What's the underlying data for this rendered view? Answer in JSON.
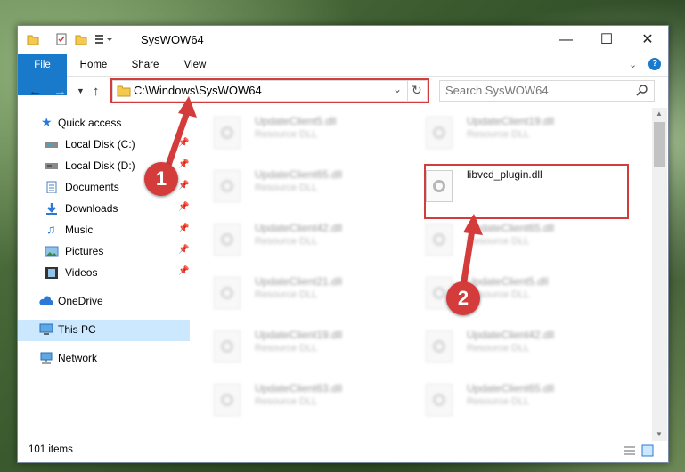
{
  "window": {
    "title": "SysWOW64"
  },
  "ribbon": {
    "tabs": [
      "File",
      "Home",
      "Share",
      "View"
    ]
  },
  "address": {
    "path": "C:\\Windows\\SysWOW64"
  },
  "search": {
    "placeholder": "Search SysWOW64"
  },
  "sidebar": {
    "quick_access": "Quick access",
    "items": [
      {
        "label": "Local Disk (C:)",
        "icon": "drive-icon",
        "pinned": true
      },
      {
        "label": "Local Disk (D:)",
        "icon": "drive-icon",
        "pinned": true
      },
      {
        "label": "Documents",
        "icon": "documents-icon",
        "pinned": true
      },
      {
        "label": "Downloads",
        "icon": "download-icon",
        "pinned": true
      },
      {
        "label": "Music",
        "icon": "music-icon",
        "pinned": true
      },
      {
        "label": "Pictures",
        "icon": "pictures-icon",
        "pinned": true
      },
      {
        "label": "Videos",
        "icon": "videos-icon",
        "pinned": true
      }
    ],
    "onedrive": "OneDrive",
    "this_pc": "This PC",
    "network": "Network"
  },
  "files": {
    "left": [
      {
        "name": "UpdateClient5.dll",
        "type": "Resource DLL"
      },
      {
        "name": "UpdateClient65.dll",
        "type": "Resource DLL"
      },
      {
        "name": "UpdateClient42.dll",
        "type": "Resource DLL"
      },
      {
        "name": "UpdateClient21.dll",
        "type": "Resource DLL"
      },
      {
        "name": "UpdateClient19.dll",
        "type": "Resource DLL"
      },
      {
        "name": "UpdateClient63.dll",
        "type": "Resource DLL"
      }
    ],
    "right": [
      {
        "name": "UpdateClient19.dll",
        "type": "Resource DLL"
      },
      {
        "name": "libvcd_plugin.dll",
        "type": ""
      },
      {
        "name": "UpdateClient65.dll",
        "type": "Resource DLL"
      },
      {
        "name": "UpdateClient5.dll",
        "type": "Resource DLL"
      },
      {
        "name": "UpdateClient42.dll",
        "type": "Resource DLL"
      },
      {
        "name": "UpdateClient65.dll",
        "type": "Resource DLL"
      }
    ]
  },
  "status": {
    "item_count": "101 items"
  },
  "annotations": {
    "step1": "1",
    "step2": "2"
  },
  "colors": {
    "accent": "#1979ca",
    "annotation": "#d43b3b",
    "selected": "#cce8ff"
  }
}
